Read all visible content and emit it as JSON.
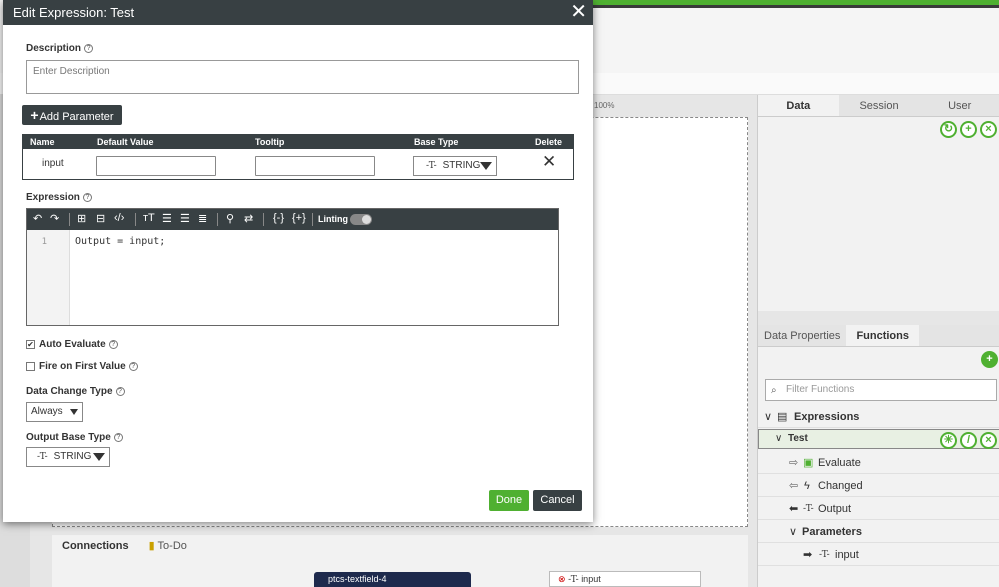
{
  "background": {
    "zoom": "100%",
    "right_tabs": [
      "Data",
      "Session",
      "User"
    ],
    "lower_tabs": [
      "Data Properties",
      "Functions"
    ],
    "filter_placeholder": "Filter Functions",
    "tree": {
      "expressions": "Expressions",
      "test": "Test",
      "evaluate": "Evaluate",
      "changed": "Changed",
      "output": "Output",
      "parameters": "Parameters",
      "input": "input"
    },
    "bottom_tabs": [
      "Connections",
      "To-Do"
    ],
    "node_left": "ptcs-textfield-4",
    "node_right": "input"
  },
  "modal": {
    "title": "Edit Expression: Test",
    "description_label": "Description",
    "description_placeholder": "Enter Description",
    "add_parameter": "Add Parameter",
    "table": {
      "headers": [
        "Name",
        "Default Value",
        "Tooltip",
        "Base Type",
        "Delete"
      ],
      "rows": [
        {
          "name": "input",
          "default_value": "",
          "tooltip": "",
          "base_type": "STRING"
        }
      ]
    },
    "expression_label": "Expression",
    "linting_label": "Linting",
    "code_line_number": "1",
    "code": "Output = input;",
    "auto_evaluate": {
      "label": "Auto Evaluate",
      "checked": true
    },
    "fire_first": {
      "label": "Fire on First Value",
      "checked": false
    },
    "data_change_label": "Data Change Type",
    "data_change_value": "Always",
    "output_base_label": "Output Base Type",
    "output_base_value": "STRING",
    "done": "Done",
    "cancel": "Cancel"
  },
  "colors": {
    "accent": "#4fb031",
    "dark": "#384043"
  }
}
